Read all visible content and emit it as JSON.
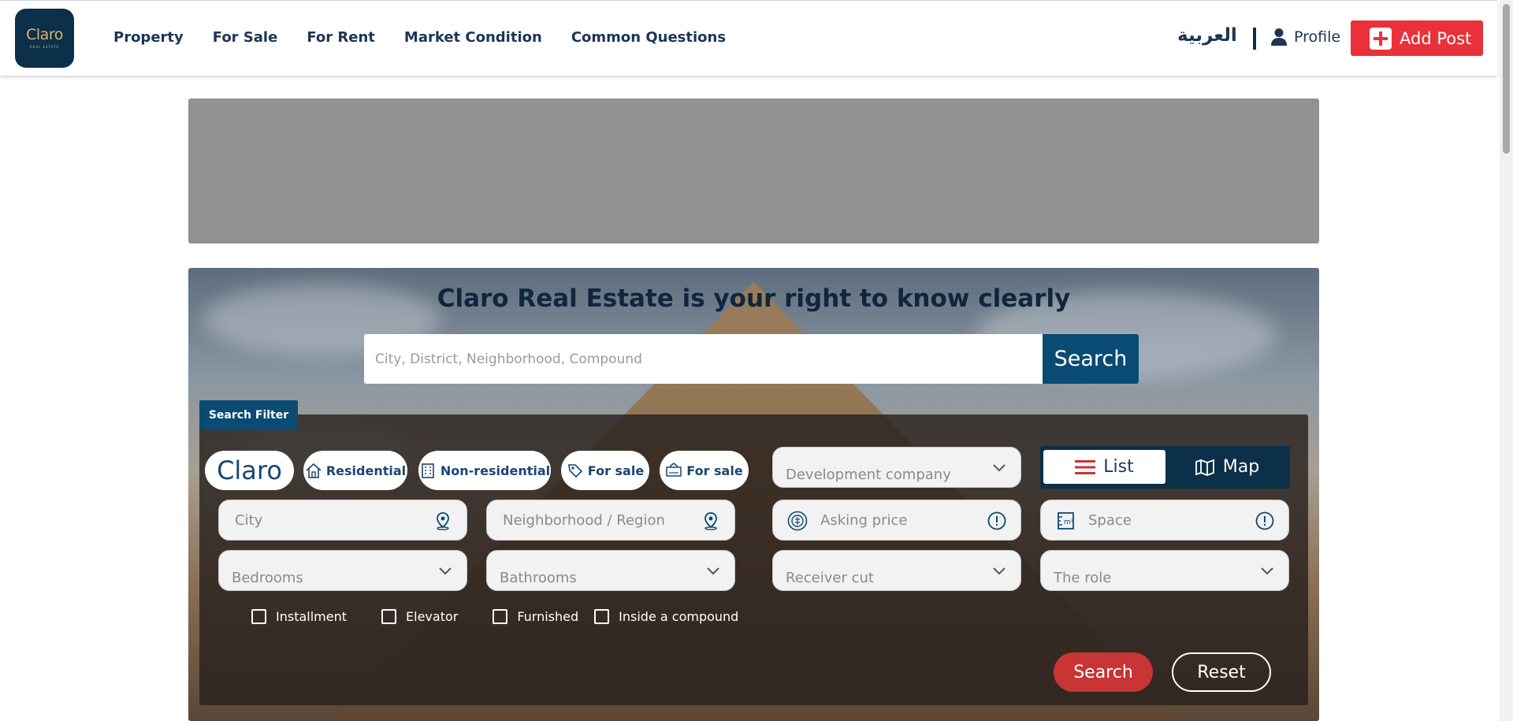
{
  "logo": {
    "word": "Claro",
    "sub": "REAL ESTATE"
  },
  "nav": [
    "Property",
    "For Sale",
    "For Rent",
    "Market Condition",
    "Common Questions"
  ],
  "header": {
    "language": "العربية",
    "profile_label": "Profile",
    "add_post_label": "Add Post"
  },
  "colors": {
    "brand_navy": "#0c2f4a",
    "accent_red": "#e8313a",
    "search_blue": "#0a4b73"
  },
  "hero": {
    "title": "Claro Real Estate is your right to know clearly",
    "search_placeholder": "City, District, Neighborhood, Compound",
    "search_button": "Search"
  },
  "filter": {
    "tag": "Search Filter",
    "pills": [
      "Claro",
      "Residential",
      "Non-residential",
      "For sale",
      "For sale"
    ],
    "development_company": "Development company",
    "view_toggle": {
      "list": "List",
      "map": "Map"
    },
    "city": "City",
    "neighborhood": "Neighborhood / Region",
    "asking_price": "Asking price",
    "space": "Space",
    "bedrooms": "Bedrooms",
    "bathrooms": "Bathrooms",
    "receiver_cut": "Receiver cut",
    "role": "The role",
    "checkboxes": [
      "Installment",
      "Elevator",
      "Furnished",
      "Inside a compound"
    ],
    "search_button": "Search",
    "reset_button": "Reset"
  }
}
